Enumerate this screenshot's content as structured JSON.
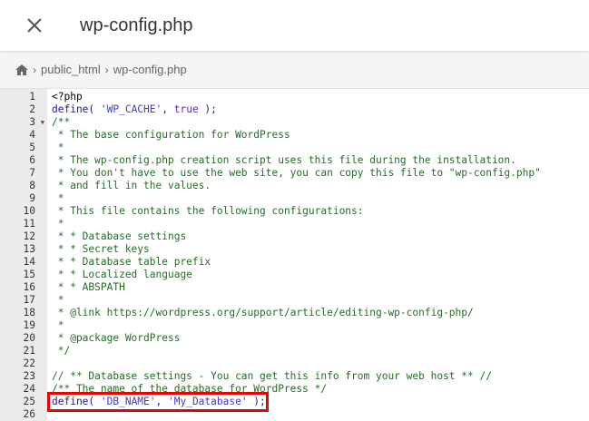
{
  "header": {
    "title": "wp-config.php",
    "close_icon": "close-icon"
  },
  "breadcrumb": {
    "home_icon": "home-icon",
    "items": [
      "public_html",
      "wp-config.php"
    ]
  },
  "editor": {
    "lines": [
      [
        [
          "",
          "<?php"
        ]
      ],
      [
        [
          "k",
          "define( "
        ],
        [
          "s",
          "'WP_CACHE'"
        ],
        [
          "k",
          ", "
        ],
        [
          "b",
          "true"
        ],
        [
          "k",
          " );"
        ]
      ],
      [
        [
          "c",
          "/**"
        ]
      ],
      [
        [
          "c",
          " * The base configuration for WordPress"
        ]
      ],
      [
        [
          "c",
          " *"
        ]
      ],
      [
        [
          "c",
          " * The wp-config.php creation script uses this file during the installation."
        ]
      ],
      [
        [
          "c",
          " * You don't have to use the web site, you can copy this file to \"wp-config.php\""
        ]
      ],
      [
        [
          "c",
          " * and fill in the values."
        ]
      ],
      [
        [
          "c",
          " *"
        ]
      ],
      [
        [
          "c",
          " * This file contains the following configurations:"
        ]
      ],
      [
        [
          "c",
          " *"
        ]
      ],
      [
        [
          "c",
          " * * Database settings"
        ]
      ],
      [
        [
          "c",
          " * * Secret keys"
        ]
      ],
      [
        [
          "c",
          " * * Database table prefix"
        ]
      ],
      [
        [
          "c",
          " * * Localized language"
        ]
      ],
      [
        [
          "c",
          " * * ABSPATH"
        ]
      ],
      [
        [
          "c",
          " *"
        ]
      ],
      [
        [
          "c",
          " * @link https://wordpress.org/support/article/editing-wp-config-php/"
        ]
      ],
      [
        [
          "c",
          " *"
        ]
      ],
      [
        [
          "c",
          " * @package WordPress"
        ]
      ],
      [
        [
          "c",
          " */"
        ]
      ],
      [],
      [
        [
          "c",
          "// ** Database settings - You can get this info from your web host ** //"
        ]
      ],
      [
        [
          "c",
          "/** The name of the database for WordPress */"
        ]
      ],
      [
        [
          "k",
          "define( "
        ],
        [
          "s",
          "'DB_NAME'"
        ],
        [
          "k",
          ", "
        ],
        [
          "s",
          "'My_Database'"
        ],
        [
          "k",
          " );"
        ]
      ],
      []
    ],
    "fold_line": 3,
    "highlighted_line": 25
  }
}
